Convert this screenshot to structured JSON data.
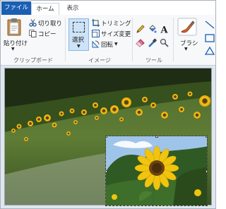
{
  "tabs": {
    "file": "ファイル",
    "home": "ホーム",
    "view": "表示"
  },
  "clipboard": {
    "paste": "貼り付け",
    "cut": "切り取り",
    "copy": "コピー",
    "group": "クリップボード"
  },
  "image": {
    "select": "選択",
    "crop": "トリミング",
    "resize": "サイズ変更",
    "rotate": "回転",
    "group": "イメージ"
  },
  "tools": {
    "group": "ツール"
  },
  "brush": {
    "label": "ブラシ"
  },
  "colors": {
    "accent": "#1a5fb4",
    "selection_bg": "#cde3f7"
  }
}
